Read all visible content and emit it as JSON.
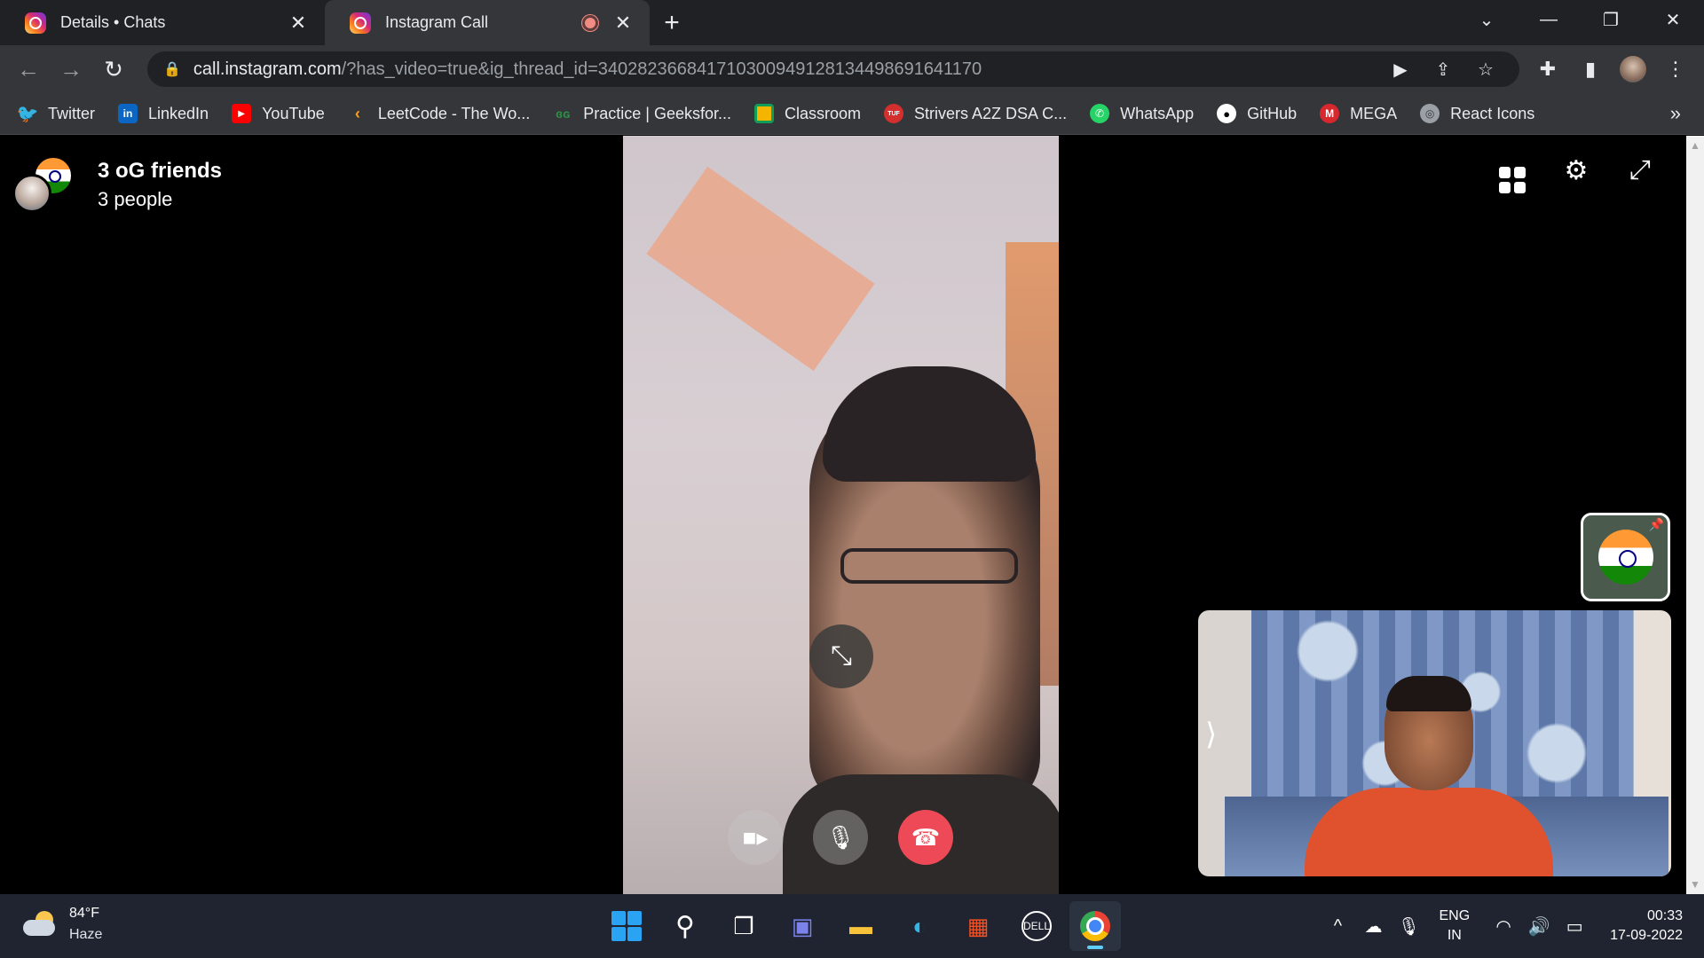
{
  "browser": {
    "tabs": [
      {
        "title": "Details • Chats",
        "active": false,
        "recording": false
      },
      {
        "title": "Instagram Call",
        "active": true,
        "recording": true
      }
    ],
    "new_tab_symbol": "+",
    "close_symbol": "✕",
    "address": {
      "host": "call.instagram.com",
      "path": "/?has_video=true&ig_thread_id=340282366841710300949128134498691641170"
    },
    "bookmarks": [
      {
        "label": "Twitter",
        "icon": "twitter-icon",
        "color": "#1da1f2"
      },
      {
        "label": "LinkedIn",
        "icon": "linkedin-icon",
        "color": "#0a66c2"
      },
      {
        "label": "YouTube",
        "icon": "youtube-icon",
        "color": "#ff0000"
      },
      {
        "label": "LeetCode - The Wo...",
        "icon": "leetcode-icon",
        "color": "#ffa116"
      },
      {
        "label": "Practice | Geeksfor...",
        "icon": "geeksforgeeks-icon",
        "color": "#2f8d46"
      },
      {
        "label": "Classroom",
        "icon": "classroom-icon",
        "color": "#f4b400"
      },
      {
        "label": "Strivers A2Z DSA C...",
        "icon": "tuf-icon",
        "color": "#d32f2f"
      },
      {
        "label": "WhatsApp",
        "icon": "whatsapp-icon",
        "color": "#25d366"
      },
      {
        "label": "GitHub",
        "icon": "github-icon",
        "color": "#ffffff"
      },
      {
        "label": "MEGA",
        "icon": "mega-icon",
        "color": "#d9272e"
      },
      {
        "label": "React Icons",
        "icon": "react-icons-icon",
        "color": "#9aa0a6"
      }
    ]
  },
  "call": {
    "group_name": "3 oG friends",
    "participants": "3 people",
    "colors": {
      "end_call": "#ed4956"
    }
  },
  "taskbar": {
    "weather": {
      "temp": "84°F",
      "condition": "Haze"
    },
    "lang": {
      "line1": "ENG",
      "line2": "IN"
    },
    "clock": {
      "time": "00:33",
      "date": "17-09-2022"
    }
  }
}
